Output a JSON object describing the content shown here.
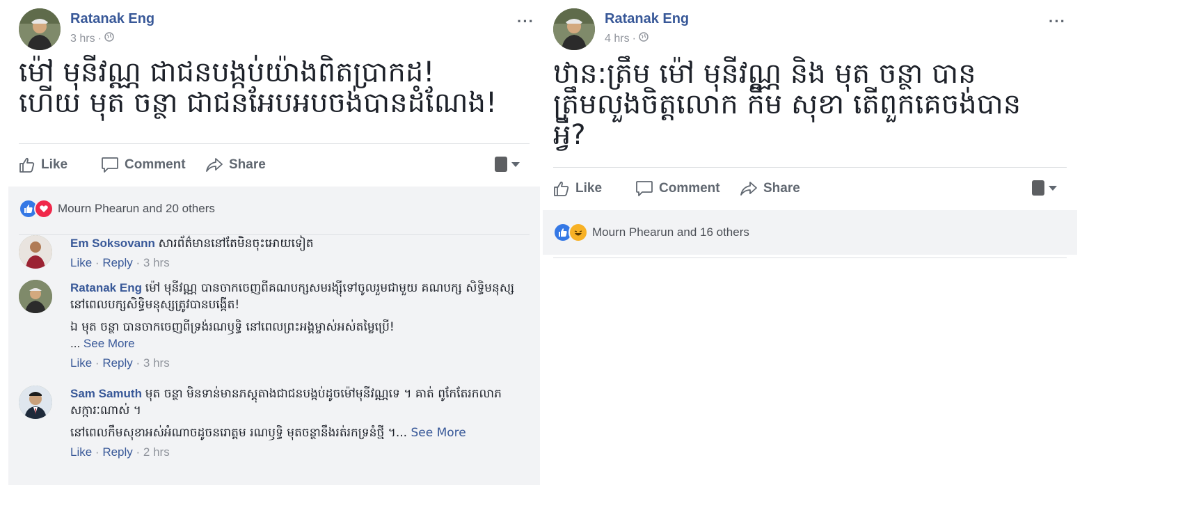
{
  "post1": {
    "author": "Ratanak Eng",
    "time": "3 hrs",
    "message": "ម៉ៅ មុនីវណ្ណ ជាជនបង្កប់យ៉ាងពិតប្រាកដ!\nហើយ មុត ចន្ថា ជាជនអែបអបចង់បានដំណែង!",
    "actions": {
      "like": "Like",
      "comment": "Comment",
      "share": "Share"
    },
    "reactions_text": "Mourn Phearun and 20 others",
    "comments": [
      {
        "name": "Em Soksovann",
        "text": "សារព័ត៌មាននៅតែមិនចុះអោយទៀត",
        "para2": "",
        "see_more": "",
        "like": "Like",
        "reply": "Reply",
        "time": "3 hrs"
      },
      {
        "name": "Ratanak Eng",
        "text": "ម៉ៅ មុនីវណ្ណ បានចាកចេញពីគណបក្សសមរង្ស៊ីទៅចូលរួមជាមួយ គណបក្ស សិទ្ធិមនុស្ស នៅពេលបក្សសិទ្ធិមនុស្សត្រូវបានបង្កើត!",
        "para2": "ឯ មុត ចន្ថា បានចាកចេញពីទ្រង់រណឫទ្ធិ នៅពេលព្រះអង្គម្ចាស់អស់តម្លៃប្រើ!",
        "see_more": "See More",
        "like": "Like",
        "reply": "Reply",
        "time": "3 hrs"
      },
      {
        "name": "Sam Samuth",
        "text": "មុត ចន្ថា មិនទាន់មានភស្តុតាងជាជនបង្កប់ដូចម៉ៅមុនីវណ្ណទេ ។ គាត់ ពូកែតែរកលាភសក្ការៈណាស់ ។",
        "para2": "នៅពេលកឹមសុខាអស់អំណាចដូចនរោត្តម រណឫទ្ធិ មុតចន្ថានឹងរត់រកទ្រនំថ្មី ។",
        "see_more": "See More",
        "like": "Like",
        "reply": "Reply",
        "time": "2 hrs"
      }
    ]
  },
  "post2": {
    "author": "Ratanak Eng",
    "time": "4 hrs",
    "message": "ឋាន:ត្រឹម ម៉ៅ មុនីវណ្ណ និង មុត ចន្ថា បាន\nត្រឹមលួងចិត្តលោក កឹម សុខា តើពួកគេចង់បាន\nអ្វី?",
    "actions": {
      "like": "Like",
      "comment": "Comment",
      "share": "Share"
    },
    "reactions_text": "Mourn Phearun and 16 others"
  },
  "icons": {
    "globe": "globe-icon",
    "more": "ellipsis-icon",
    "like": "thumbs-up-icon",
    "comment": "speech-bubble-icon",
    "share": "share-arrow-icon",
    "reaction_like": "like-reaction-icon",
    "reaction_love": "love-reaction-icon",
    "reaction_haha": "haha-reaction-icon"
  },
  "colors": {
    "link": "#385898",
    "secondary": "#90949c",
    "ufi_bg": "#f2f3f5",
    "like_blue": "#3578e5",
    "love_red": "#f0284a"
  }
}
